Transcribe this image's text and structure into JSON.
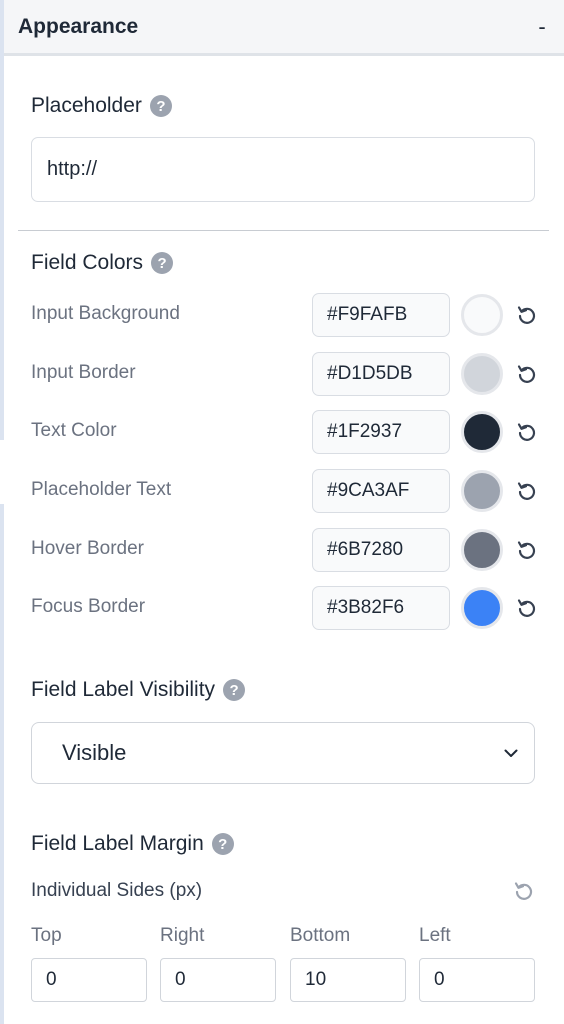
{
  "panel": {
    "title": "Appearance",
    "collapse_label": "-"
  },
  "placeholder": {
    "label": "Placeholder",
    "help": "?",
    "value": "http://"
  },
  "field_colors": {
    "label": "Field Colors",
    "help": "?",
    "items": [
      {
        "name": "Input Background",
        "hex": "#F9FAFB",
        "swatch": "#F9FAFB"
      },
      {
        "name": "Input Border",
        "hex": "#D1D5DB",
        "swatch": "#D1D5DB"
      },
      {
        "name": "Text Color",
        "hex": "#1F2937",
        "swatch": "#1F2937"
      },
      {
        "name": "Placeholder Text",
        "hex": "#9CA3AF",
        "swatch": "#9CA3AF"
      },
      {
        "name": "Hover Border",
        "hex": "#6B7280",
        "swatch": "#6B7280"
      },
      {
        "name": "Focus Border",
        "hex": "#3B82F6",
        "swatch": "#3B82F6"
      }
    ]
  },
  "label_visibility": {
    "label": "Field Label Visibility",
    "help": "?",
    "selected": "Visible"
  },
  "label_margin": {
    "label": "Field Label Margin",
    "help": "?",
    "sides_label": "Individual Sides (px)",
    "sides": [
      {
        "label": "Top",
        "value": "0"
      },
      {
        "label": "Right",
        "value": "0"
      },
      {
        "label": "Bottom",
        "value": "10"
      },
      {
        "label": "Left",
        "value": "0"
      }
    ]
  },
  "icons": {
    "help": "question-circle-icon",
    "reset": "reset-icon",
    "dropdown": "chevron-down-icon"
  }
}
